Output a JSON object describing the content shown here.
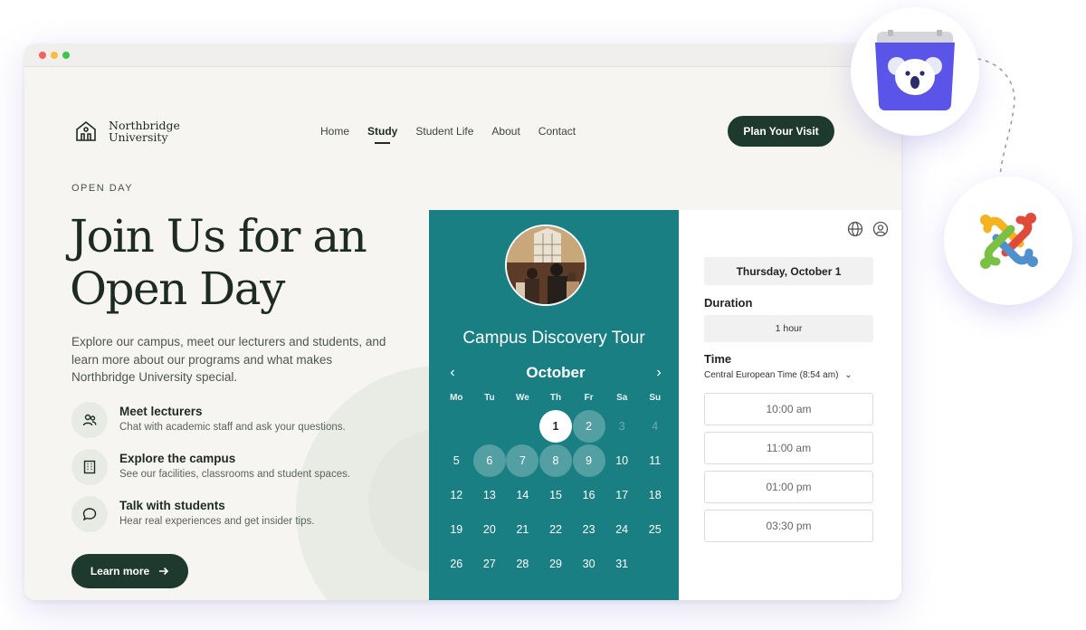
{
  "header": {
    "logo_line1": "Northbridge",
    "logo_line2": "University",
    "nav": [
      "Home",
      "Study",
      "Student Life",
      "About",
      "Contact"
    ],
    "active_nav": "Study",
    "cta": "Plan Your Visit"
  },
  "hero": {
    "eyebrow": "OPEN DAY",
    "title": "Join Us for an Open Day",
    "description": "Explore our campus, meet our lecturers and students, and learn more about our programs and what makes Northbridge University special.",
    "features": [
      {
        "title": "Meet lecturers",
        "subtitle": "Chat with academic staff and ask your questions.",
        "icon": "people-icon"
      },
      {
        "title": "Explore the campus",
        "subtitle": "See our facilities, classrooms and student spaces.",
        "icon": "building-icon"
      },
      {
        "title": "Talk with students",
        "subtitle": "Hear real experiences and get insider tips.",
        "icon": "chat-bubble-icon"
      }
    ],
    "learn_more": "Learn more"
  },
  "booking": {
    "title": "Campus Discovery Tour",
    "month": "October",
    "prev": "‹",
    "next": "›",
    "weekdays": [
      "Mo",
      "Tu",
      "We",
      "Th",
      "Fr",
      "Sa",
      "Su"
    ],
    "weeks": [
      [
        "",
        "",
        "",
        "1",
        "2",
        "3",
        "4"
      ],
      [
        "5",
        "6",
        "7",
        "8",
        "9",
        "10",
        "11"
      ],
      [
        "12",
        "13",
        "14",
        "15",
        "16",
        "17",
        "18"
      ],
      [
        "19",
        "20",
        "21",
        "22",
        "23",
        "24",
        "25"
      ],
      [
        "26",
        "27",
        "28",
        "29",
        "30",
        "31",
        ""
      ]
    ],
    "selected_day": "1",
    "available_days": [
      "2",
      "6",
      "7",
      "8",
      "9"
    ],
    "muted_days": [
      "3",
      "4"
    ],
    "selected_date": "Thursday, October 1",
    "duration_label": "Duration",
    "duration_value": "1 hour",
    "time_label": "Time",
    "timezone": "Central European Time (8:54 am)",
    "timezone_caret": "⌄",
    "slots": [
      "10:00 am",
      "11:00 am",
      "01:00 pm",
      "03:30 pm"
    ]
  },
  "colors": {
    "brand_dark": "#1e3a2f",
    "widget_teal": "#1a7f83",
    "page_bg": "#f7f5f1"
  }
}
